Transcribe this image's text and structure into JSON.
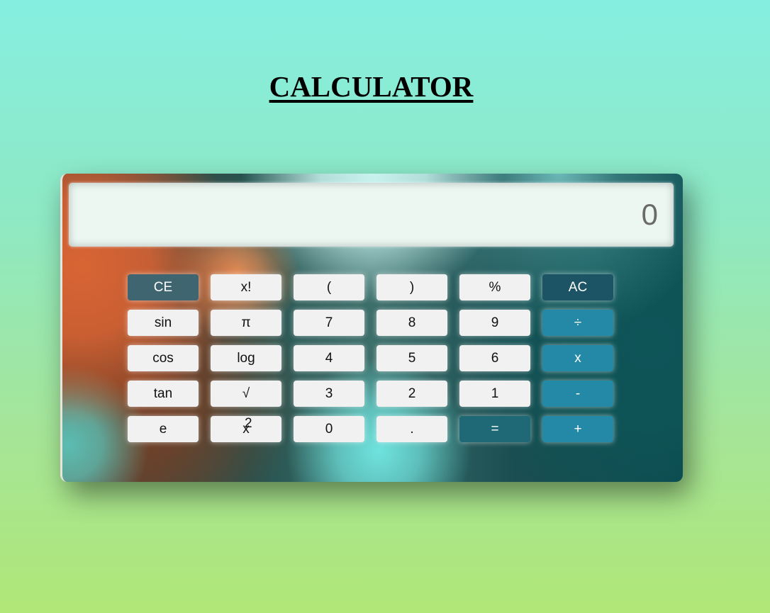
{
  "page": {
    "title": "CALCULATOR"
  },
  "display": {
    "value": "0"
  },
  "keys": {
    "ce": "CE",
    "factorial": "x!",
    "lparen": "(",
    "rparen": ")",
    "percent": "%",
    "ac": "AC",
    "sin": "sin",
    "pi": "π",
    "seven": "7",
    "eight": "8",
    "nine": "9",
    "divide": "÷",
    "cos": "cos",
    "log": "log",
    "four": "4",
    "five": "5",
    "six": "6",
    "multiply": "x",
    "tan": "tan",
    "sqrt": "√",
    "three": "3",
    "two": "2",
    "one": "1",
    "subtract": "-",
    "e": "e",
    "square_base": "x",
    "square_exp": "2",
    "zero": "0",
    "dot": ".",
    "equals": "=",
    "add": "+"
  },
  "colors": {
    "background_top": "#86eee0",
    "background_bottom": "#b0e777",
    "display_bg": "#ecf7f2",
    "key_bg": "#f1f1f1",
    "operator_bg": "#2389a6",
    "clear_entry_bg": "#3f6670",
    "all_clear_bg": "#1d5465",
    "equals_bg": "#1f6876"
  }
}
